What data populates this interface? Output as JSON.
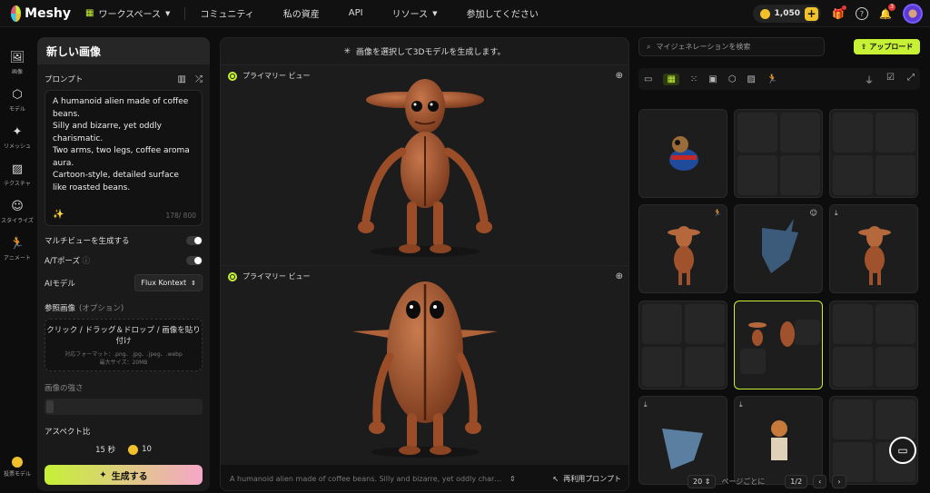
{
  "app": {
    "name": "Meshy"
  },
  "nav": {
    "workspace": "ワークスペース",
    "community": "コミュニティ",
    "assets": "私の資産",
    "api": "API",
    "resources": "リソース",
    "join": "参加してください"
  },
  "account": {
    "credits": "1,050",
    "notifications": "3"
  },
  "rail": {
    "items": [
      "画像",
      "モデル",
      "リメッシュ",
      "テクスチャ",
      "スタイライズ",
      "アニメート"
    ],
    "bottom": "投票モデル"
  },
  "panel": {
    "title": "新しい画像",
    "prompt_label": "プロンプト",
    "prompt_text": "A humanoid alien made of coffee beans.\nSilly and bizarre, yet oddly charismatic.\nTwo arms, two legs, coffee aroma aura.\nCartoon-style, detailed surface like roasted beans.",
    "prompt_count": "178/ 800",
    "multiview_label": "マルチビューを生成する",
    "apose_label": "A/Tポーズ",
    "ai_model_label": "AIモデル",
    "ai_model_value": "Flux Kontext",
    "ref_label": "参照画像",
    "ref_optional": "(オプション)",
    "drop_main": "クリック / ドラッグ＆ドロップ / 画像を貼り付け",
    "drop_formats": "対応フォーマット：.png、.jpg、.jpeg、.webp",
    "drop_size": "最大サイズ：20MB",
    "strength_label": "画像の強さ",
    "aspect_label": "アスペクト比",
    "time": "15 秒",
    "cost": "10",
    "generate": "生成する"
  },
  "center": {
    "header": "画像を選択して3Dモデルを生成します。",
    "view1_label": "プライマリー ビュー",
    "view2_label": "プライマリー ビュー",
    "bottom_prompt": "A humanoid alien made of coffee beans. Silly and bizarre, yet oddly charism...",
    "reuse": "再利用プロンプト"
  },
  "right": {
    "search_placeholder": "マイジェネレーションを検索",
    "upload": "アップロード",
    "per_page": "20",
    "per_page_label": "ページごとに",
    "page": "1/2"
  },
  "colors": {
    "accent": "#c6f135",
    "coin": "#f0c12a",
    "bean": "#a0522d"
  }
}
